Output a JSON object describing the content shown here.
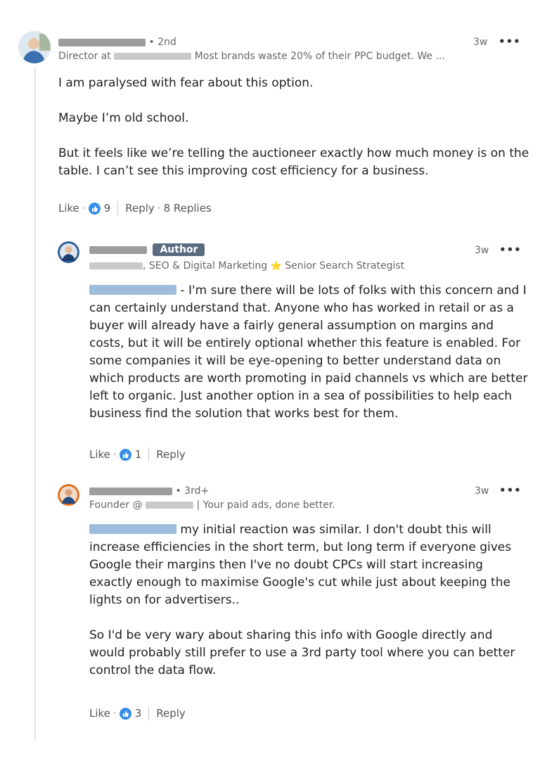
{
  "comment": {
    "degree": " • 2nd",
    "headline_prefix": "Director at ",
    "headline_suffix": " Most brands waste 20% of their PPC budget. We ...",
    "time": "3w",
    "more": "•••",
    "paragraphs": [
      "I am paralysed with fear about this option.",
      "Maybe I’m old school.",
      "But it feels like we’re telling the auctioneer exactly how much money is on the table. I can’t see this improving cost efficiency for a business."
    ],
    "like_label": "Like",
    "like_count": "9",
    "reply_label": "Reply",
    "replies_count": "8 Replies"
  },
  "reply1": {
    "badge": "Author",
    "headline": ", SEO & Digital Marketing",
    "star": "⭐",
    "headline_tail": " Senior Search Strategist",
    "time": "3w",
    "more": "•••",
    "text": " - I'm sure there will be lots of folks with this concern and I can certainly understand that. Anyone who has worked in retail or as a buyer will already have a fairly general assumption on margins and costs, but it will be entirely optional whether this feature is enabled. For some companies it will be eye-opening to better understand data on which products are worth promoting in paid channels vs which are better left to organic. Just another option in a sea of possibilities to help each business find the solution that works best for them.",
    "like_label": "Like",
    "like_count": "1",
    "reply_label": "Reply"
  },
  "reply2": {
    "degree": " • 3rd+",
    "headline_prefix": "Founder @ ",
    "headline_suffix": " | Your paid ads, done better.",
    "time": "3w",
    "more": "•••",
    "text1": " my initial reaction was similar. I don't doubt this will increase efficiencies in the short term, but long term if everyone gives Google their margins then I've no doubt CPCs will start increasing exactly enough to maximise Google's cut while just about keeping the lights on for advertisers..",
    "text2": "So I'd be very wary about sharing this info with Google directly and would probably still prefer to use a 3rd party tool where you can better control the data flow.",
    "like_label": "Like",
    "like_count": "3",
    "reply_label": "Reply"
  },
  "colors": {
    "like_blue": "#378fe9",
    "author_badge": "#5a6b80"
  }
}
